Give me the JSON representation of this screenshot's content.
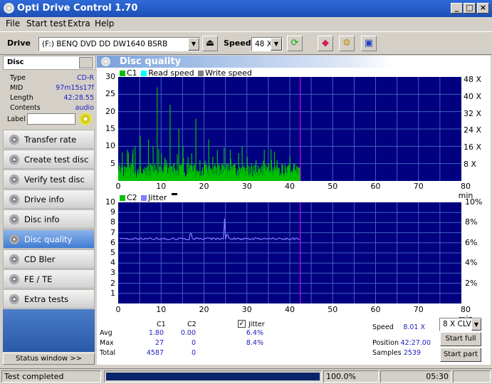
{
  "window": {
    "title": "Opti Drive Control 1.70"
  },
  "menu": {
    "items": [
      "File",
      "Start test",
      "Extra",
      "Help"
    ]
  },
  "toolbar": {
    "drive_label": "Drive",
    "drive_value": "(F:)   BENQ DVD DD DW1640 BSRB",
    "speed_label": "Speed",
    "speed_value": "48 X"
  },
  "disc": {
    "header": "Disc",
    "rows": [
      {
        "label": "Type",
        "value": "CD-R"
      },
      {
        "label": "MID",
        "value": "97m15s17f"
      },
      {
        "label": "Length",
        "value": "42:28.55"
      },
      {
        "label": "Contents",
        "value": "audio"
      }
    ],
    "label_field": "Label"
  },
  "nav": {
    "items": [
      "Transfer rate",
      "Create test disc",
      "Verify test disc",
      "Drive info",
      "Disc info",
      "Disc quality",
      "CD Bler",
      "FE / TE",
      "Extra tests"
    ],
    "active": "Disc quality",
    "status_window": "Status window >>"
  },
  "panel_title": "Disc quality",
  "chart_data": [
    {
      "type": "bar",
      "legend": [
        "C1",
        "Read speed",
        "Write speed"
      ],
      "x_ticks": [
        "0",
        "10",
        "20",
        "30",
        "40",
        "50",
        "60",
        "70",
        "80 min"
      ],
      "y_ticks_left": [
        "30",
        "25",
        "20",
        "15",
        "10",
        "5"
      ],
      "y_ticks_right": [
        "48 X",
        "40 X",
        "32 X",
        "24 X",
        "16 X",
        "8 X"
      ],
      "xlim": [
        0,
        80
      ],
      "ylim": [
        0,
        30
      ],
      "marker_x": 42.45,
      "c1_max": 27,
      "c1_avg": 1.8,
      "c1_peaks": [
        [
          2,
          9
        ],
        [
          3,
          5
        ],
        [
          5,
          13
        ],
        [
          6,
          4
        ],
        [
          7,
          12
        ],
        [
          8,
          10
        ],
        [
          9,
          27
        ],
        [
          10,
          8
        ],
        [
          11,
          6
        ],
        [
          12,
          22
        ],
        [
          13,
          5
        ],
        [
          14,
          15
        ],
        [
          15,
          10
        ],
        [
          16,
          5
        ],
        [
          17,
          8
        ],
        [
          18,
          18
        ],
        [
          19,
          6
        ],
        [
          20,
          5
        ],
        [
          21,
          12
        ],
        [
          22,
          7
        ],
        [
          23,
          9
        ],
        [
          24,
          5
        ],
        [
          25,
          4
        ],
        [
          26,
          9
        ],
        [
          27,
          5
        ],
        [
          28,
          8
        ],
        [
          29,
          4
        ],
        [
          30,
          7
        ],
        [
          31,
          5
        ],
        [
          32,
          6
        ],
        [
          33,
          4
        ],
        [
          34,
          9
        ],
        [
          35,
          5
        ],
        [
          36,
          4
        ],
        [
          37,
          6
        ],
        [
          38,
          5
        ],
        [
          39,
          4
        ],
        [
          40,
          7
        ],
        [
          41,
          5
        ],
        [
          42,
          4
        ]
      ],
      "colors": {
        "c1": "#00c000",
        "read": "#00ffff",
        "write": "#808080",
        "marker": "#ff00ff"
      }
    },
    {
      "type": "line",
      "legend": [
        "C2",
        "Jitter"
      ],
      "x_ticks": [
        "0",
        "10",
        "20",
        "30",
        "40",
        "50",
        "60",
        "70",
        "80 min"
      ],
      "y_ticks_left": [
        "10",
        "9",
        "8",
        "7",
        "6",
        "5",
        "4",
        "3",
        "2",
        "1"
      ],
      "y_ticks_right": [
        "10%",
        "8%",
        "6%",
        "4%",
        "2%"
      ],
      "xlim": [
        0,
        80
      ],
      "ylim": [
        0,
        10
      ],
      "marker_x": 42.45,
      "jitter_baseline": 6.4,
      "jitter_peaks": [
        [
          17,
          6.9
        ],
        [
          24.8,
          8.4
        ],
        [
          25.5,
          6.8
        ]
      ],
      "colors": {
        "jitter": "#8080ff",
        "marker": "#ff00ff"
      }
    }
  ],
  "stats": {
    "headers": [
      "C1",
      "C2"
    ],
    "rows": [
      {
        "label": "Avg",
        "c1": "1.80",
        "c2": "0.00",
        "jitter": "6.4%"
      },
      {
        "label": "Max",
        "c1": "27",
        "c2": "0",
        "jitter": "8.4%"
      },
      {
        "label": "Total",
        "c1": "4587",
        "c2": "0",
        "jitter": ""
      }
    ],
    "jitter_label": "Jitter",
    "jitter_checked": true
  },
  "results": {
    "speed_label": "Speed",
    "speed_value": "8.01 X",
    "position_label": "Position",
    "position_value": "42:27.00",
    "samples_label": "Samples",
    "samples_value": "2539",
    "mode_value": "8 X CLV",
    "start_full": "Start full",
    "start_part": "Start part"
  },
  "status": {
    "text": "Test completed",
    "percent": "100.0%",
    "time": "05:30",
    "progress": 1.0
  }
}
